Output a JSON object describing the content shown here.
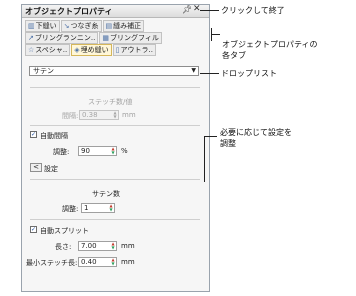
{
  "panel": {
    "title": "オブジェクトプロパティ",
    "pin_icon": "pin-icon",
    "close_icon": "close-icon",
    "tabs_row1": [
      {
        "label": "下縫い",
        "icon": "underlay-icon"
      },
      {
        "label": "つなぎ糸",
        "icon": "connector-icon"
      },
      {
        "label": "縫み補正",
        "icon": "pull-comp-icon"
      }
    ],
    "tabs_row2": [
      {
        "label": "ブリングランニン..",
        "icon": "running-icon"
      },
      {
        "label": "ブリングフィル",
        "icon": "fill-icon"
      }
    ],
    "tabs_row3": [
      {
        "label": "スペシャ..",
        "icon": "star-icon"
      },
      {
        "label": "埋め縫い",
        "icon": "fill-stitch-icon",
        "active": true
      },
      {
        "label": "アウトラ..",
        "icon": "outline-icon"
      }
    ],
    "dropdown_value": "サテン",
    "stitch_count_section": "ステッチ数/値",
    "spacing": {
      "label": "間隔:",
      "value": "0.38",
      "unit": "mm"
    },
    "auto_spacing": {
      "label": "自動間隔",
      "checked": true
    },
    "adjust1": {
      "label": "調整:",
      "value": "90",
      "unit": "%"
    },
    "settings_button": {
      "arrow": "<",
      "label": "設定"
    },
    "satin_count_label": "サテン数",
    "adjust2": {
      "label": "調整:",
      "value": "1"
    },
    "auto_split": {
      "label": "自動スプリット",
      "checked": true
    },
    "length": {
      "label": "長さ:",
      "value": "7.00",
      "unit": "mm"
    },
    "min_stitch": {
      "label": "最小ステッチ長:",
      "value": "0.40",
      "unit": "mm"
    }
  },
  "callouts": {
    "close": "クリックして終了",
    "tabs_line1": "オブジェクトプロパティの",
    "tabs_line2": "各タブ",
    "dropdown": "ドロップリスト",
    "adjust_line1": "必要に応じて設定を",
    "adjust_line2": "調整"
  }
}
